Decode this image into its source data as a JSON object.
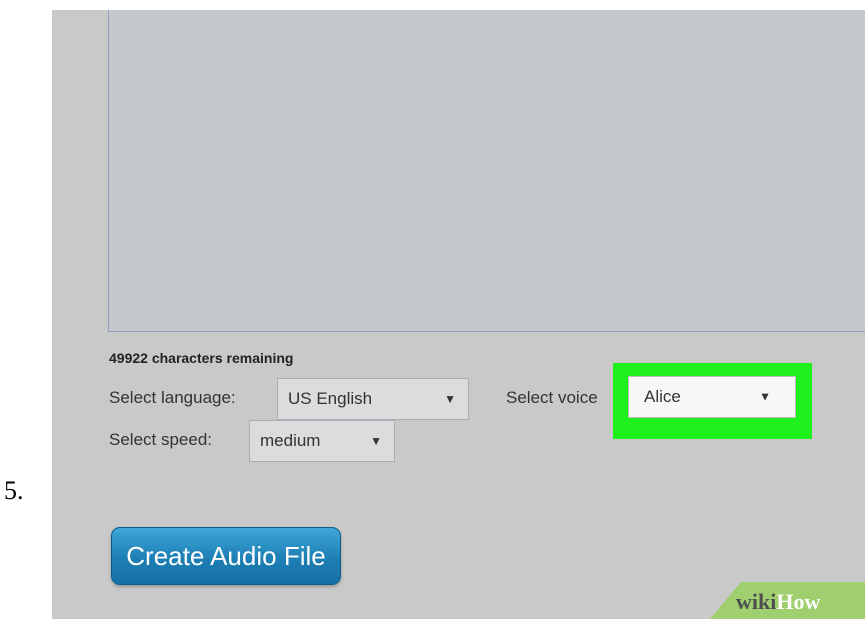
{
  "step_number": "5.",
  "form": {
    "chars_remaining": "49922 characters remaining",
    "language_label": "Select language:",
    "language_value": "US English",
    "voice_label": "Select voice",
    "voice_value": "Alice",
    "speed_label": "Select speed:",
    "speed_value": "medium"
  },
  "create_button": "Create Audio File",
  "watermark": {
    "part1": "wiki",
    "part2": "How"
  },
  "colors": {
    "highlight": "#1df01d",
    "button": "#1d7fb5",
    "watermark_band": "#9fcf6f"
  },
  "icons": {
    "dropdown": "dropdown-triangle-icon"
  }
}
